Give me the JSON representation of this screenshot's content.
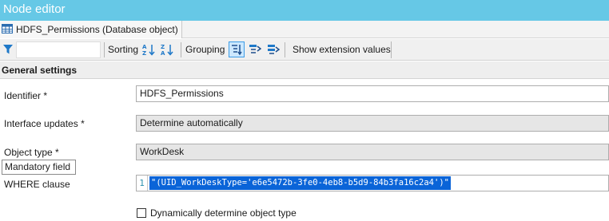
{
  "window": {
    "title": "Node editor"
  },
  "object_tab": {
    "label": "HDFS_Permissions (Database object)"
  },
  "toolbar": {
    "filter_value": "",
    "sorting_label": "Sorting",
    "grouping_label": "Grouping",
    "show_extension_label": "Show extension values"
  },
  "section": {
    "title": "General settings"
  },
  "fields": {
    "identifier": {
      "label": "Identifier *",
      "value": "HDFS_Permissions"
    },
    "interface_updates": {
      "label": "Interface updates *",
      "value": "Determine automatically"
    },
    "object_type": {
      "label": "Object type *",
      "value": "WorkDesk"
    },
    "where_clause": {
      "label": "WHERE clause",
      "line_number": "1",
      "value": "\"(UID_WorkDeskType='e6e5472b-3fe0-4eb8-b5d9-84b3fa16c2a4')\""
    }
  },
  "tooltip": {
    "text": "Mandatory field"
  },
  "checkbox": {
    "label": "Dynamically determine object type",
    "checked": false
  },
  "colors": {
    "title_bar": "#66c8e6",
    "selection": "#0a64d8",
    "active_button": "#cce8ff"
  }
}
